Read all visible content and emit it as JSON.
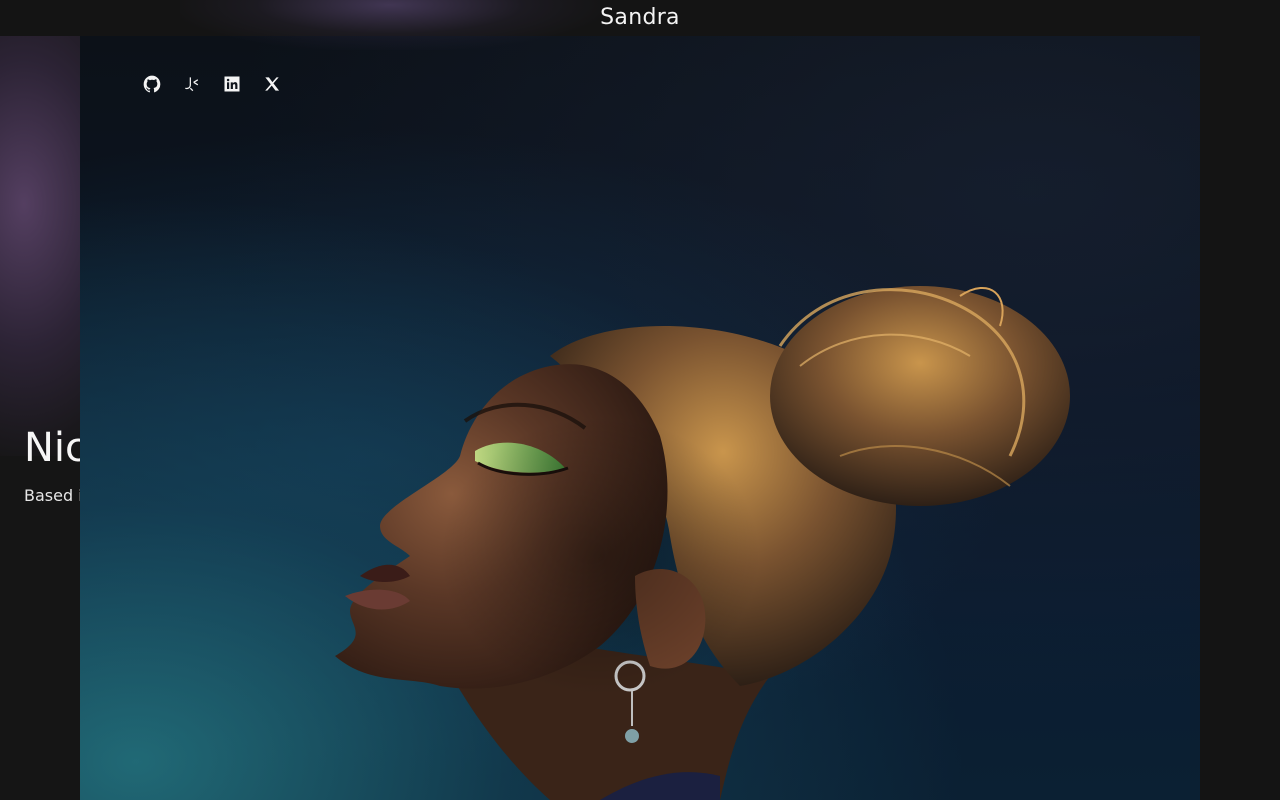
{
  "header": {
    "brand": "Sandra"
  },
  "hero": {
    "name": "Nic",
    "subtitle": "Based i"
  },
  "social": [
    {
      "icon": "github-icon"
    },
    {
      "icon": "codepen-icon"
    },
    {
      "icon": "linkedin-icon"
    },
    {
      "icon": "x-icon"
    }
  ],
  "colors": {
    "background": "#151515",
    "text": "#f4f4f4",
    "accent_purple": "#5f466e",
    "photo_teal": "#2f8a96"
  }
}
